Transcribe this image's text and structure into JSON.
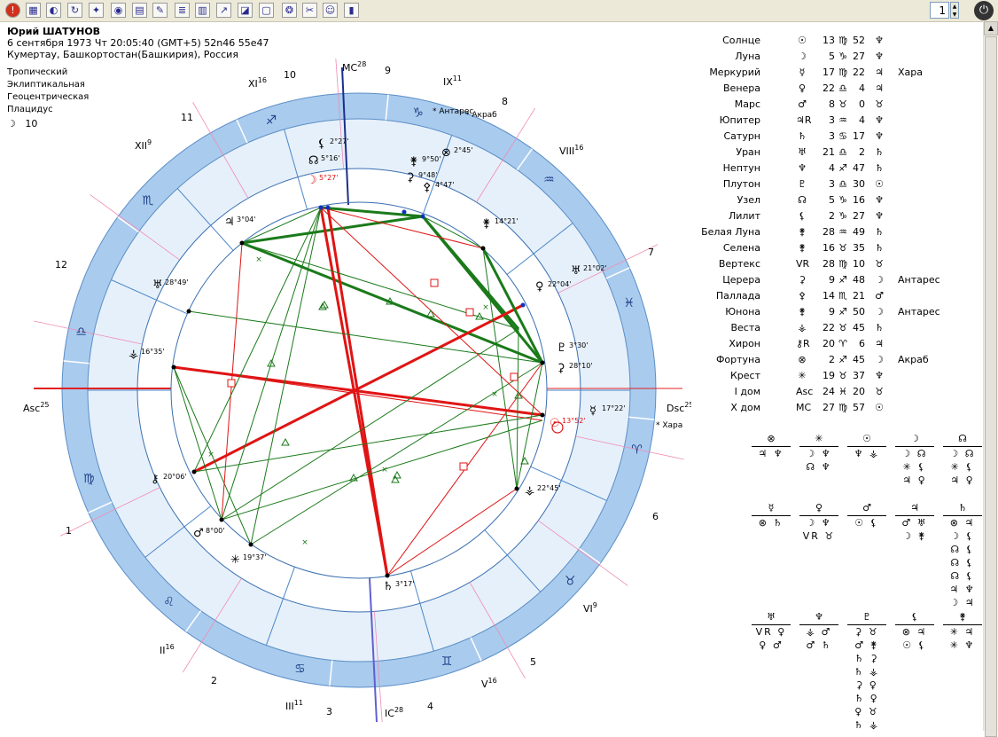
{
  "toolbar": {
    "buttons": [
      "exclamation-icon",
      "grid-icon",
      "globe-icon",
      "refresh-icon",
      "star-map-icon",
      "orbit-icon",
      "calendar-icon",
      "pen-icon",
      "list-icon",
      "chart-icon",
      "transit-icon",
      "graph-icon",
      "page-icon",
      "wheel-icon",
      "tools-icon",
      "person-icon",
      "bars-icon"
    ],
    "page_value": "1",
    "exit_icon": "power-icon"
  },
  "header": {
    "name": "Юрий ШАТУНОВ",
    "line1": "6 сентября 1973  Чт  20:05:40 (GMT+5) 52n46  55e47",
    "line2": "Кумертау, Башкортостан(Башкирия), Россия"
  },
  "systems": [
    "Тропический",
    "Эклиптикальная",
    "Геоцентрическая",
    "Плацидус"
  ],
  "moon_day": {
    "symbol": "☽",
    "value": "10"
  },
  "axes": {
    "mc": "MC",
    "mc_deg": "28",
    "ic": "IC",
    "ic_deg": "28",
    "asc": "Asc",
    "asc_deg": "25",
    "dsc": "Dsc",
    "dsc_deg": "25"
  },
  "houses": [
    {
      "label": "XI",
      "deg": "16"
    },
    {
      "label": "IX",
      "deg": "11"
    },
    {
      "label": "XII",
      "deg": "9"
    },
    {
      "label": "VIII",
      "deg": "16"
    },
    {
      "label": "II",
      "deg": "16"
    },
    {
      "label": "VI",
      "deg": "9"
    },
    {
      "label": "III",
      "deg": "11"
    },
    {
      "label": "V",
      "deg": "16"
    }
  ],
  "house_numbers": [
    "10",
    "9",
    "11",
    "8",
    "12",
    "7",
    "1",
    "6",
    "2",
    "5",
    "3",
    "4"
  ],
  "zodiac_signs": [
    "♑",
    "♐",
    "♒",
    "♏",
    "♓",
    "♎",
    "♈",
    "♍",
    "♉",
    "♌",
    "♊",
    "♋"
  ],
  "chart_planets": [
    {
      "sym": "⚸",
      "deg": "2°27'",
      "color": "#000"
    },
    {
      "sym": "☊",
      "deg": "5°16'",
      "color": "#000"
    },
    {
      "sym": "☽",
      "deg": "5°27'",
      "color": "#e01010"
    },
    {
      "sym": "⚵",
      "deg": "9°50'",
      "color": "#000"
    },
    {
      "sym": "⊗",
      "deg": "2°45'",
      "color": "#000"
    },
    {
      "sym": "⚳",
      "deg": "9°48'",
      "color": "#000"
    },
    {
      "sym": "⚴",
      "deg": "4°47'",
      "color": "#000"
    },
    {
      "sym": "♃",
      "deg": "3°04'",
      "color": "#000"
    },
    {
      "sym": "♅",
      "deg": "28°49'",
      "color": "#000"
    },
    {
      "sym": "⚶",
      "deg": "16°35'",
      "color": "#000"
    },
    {
      "sym": "⚷",
      "deg": "20°06'",
      "color": "#000"
    },
    {
      "sym": "♂",
      "deg": "8°00'",
      "color": "#000"
    },
    {
      "sym": "✳",
      "deg": "19°37'",
      "color": "#000"
    },
    {
      "sym": "♄",
      "deg": "3°17'",
      "color": "#000"
    },
    {
      "sym": "⚶",
      "deg": "22°45'",
      "color": "#000"
    },
    {
      "sym": "☿",
      "deg": "17°22'",
      "color": "#000"
    },
    {
      "sym": "☉",
      "deg": "13°52'",
      "color": "#e01010"
    },
    {
      "sym": "⚳",
      "deg": "28°10'",
      "color": "#000"
    },
    {
      "sym": "♇",
      "deg": "3°30'",
      "color": "#000"
    },
    {
      "sym": "♀",
      "deg": "22°04'",
      "color": "#000"
    },
    {
      "sym": "♅",
      "deg": "21°02'",
      "color": "#000"
    },
    {
      "sym": "⚵",
      "deg": "14°21'",
      "color": "#000"
    }
  ],
  "fixed_stars": [
    "Антарес",
    "Акраб",
    "Хара"
  ],
  "planet_table": [
    {
      "name": "Солнце",
      "sym": "☉",
      "deg": "13",
      "sign": "♍",
      "min": "52",
      "ruler": "♆",
      "star": ""
    },
    {
      "name": "Луна",
      "sym": "☽",
      "deg": "5",
      "sign": "♑",
      "min": "27",
      "ruler": "♆",
      "star": ""
    },
    {
      "name": "Меркурий",
      "sym": "☿",
      "deg": "17",
      "sign": "♍",
      "min": "22",
      "ruler": "♃",
      "star": "Хара"
    },
    {
      "name": "Венера",
      "sym": "♀",
      "deg": "22",
      "sign": "♎",
      "min": "4",
      "ruler": "♃",
      "star": ""
    },
    {
      "name": "Марс",
      "sym": "♂",
      "deg": "8",
      "sign": "♉",
      "min": "0",
      "ruler": "♉",
      "star": ""
    },
    {
      "name": "Юпитер",
      "sym": "♃R",
      "deg": "3",
      "sign": "♒",
      "min": "4",
      "ruler": "♆",
      "star": ""
    },
    {
      "name": "Сатурн",
      "sym": "♄",
      "deg": "3",
      "sign": "♋",
      "min": "17",
      "ruler": "♆",
      "star": ""
    },
    {
      "name": "Уран",
      "sym": "♅",
      "deg": "21",
      "sign": "♎",
      "min": "2",
      "ruler": "♄",
      "star": ""
    },
    {
      "name": "Нептун",
      "sym": "♆",
      "deg": "4",
      "sign": "♐",
      "min": "47",
      "ruler": "♄",
      "star": ""
    },
    {
      "name": "Плутон",
      "sym": "♇",
      "deg": "3",
      "sign": "♎",
      "min": "30",
      "ruler": "☉",
      "star": ""
    },
    {
      "name": "Узел",
      "sym": "☊",
      "deg": "5",
      "sign": "♑",
      "min": "16",
      "ruler": "♆",
      "star": ""
    },
    {
      "name": "Лилит",
      "sym": "⚸",
      "deg": "2",
      "sign": "♑",
      "min": "27",
      "ruler": "♆",
      "star": ""
    },
    {
      "name": "Белая Луна",
      "sym": "⚵",
      "deg": "28",
      "sign": "♒",
      "min": "49",
      "ruler": "♄",
      "star": ""
    },
    {
      "name": "Селена",
      "sym": "⚵",
      "deg": "16",
      "sign": "♉",
      "min": "35",
      "ruler": "♄",
      "star": ""
    },
    {
      "name": "Вертекс",
      "sym": "VR",
      "deg": "28",
      "sign": "♍",
      "min": "10",
      "ruler": "♉",
      "star": ""
    },
    {
      "name": "Церера",
      "sym": "⚳",
      "deg": "9",
      "sign": "♐",
      "min": "48",
      "ruler": "☽",
      "star": "Антарес"
    },
    {
      "name": "Паллада",
      "sym": "⚴",
      "deg": "14",
      "sign": "♏",
      "min": "21",
      "ruler": "♂",
      "star": ""
    },
    {
      "name": "Юнона",
      "sym": "⚵",
      "deg": "9",
      "sign": "♐",
      "min": "50",
      "ruler": "☽",
      "star": "Антарес"
    },
    {
      "name": "Веста",
      "sym": "⚶",
      "deg": "22",
      "sign": "♉",
      "min": "45",
      "ruler": "♄",
      "star": ""
    },
    {
      "name": "Хирон",
      "sym": "⚷R",
      "deg": "20",
      "sign": "♈",
      "min": "6",
      "ruler": "♃",
      "star": ""
    },
    {
      "name": "Фортуна",
      "sym": "⊗",
      "deg": "2",
      "sign": "♐",
      "min": "45",
      "ruler": "☽",
      "star": "Акраб"
    },
    {
      "name": "Крест",
      "sym": "✳",
      "deg": "19",
      "sign": "♉",
      "min": "37",
      "ruler": "♆",
      "star": ""
    },
    {
      "name": "I дом",
      "sym": "Asc",
      "deg": "24",
      "sign": "♓",
      "min": "20",
      "ruler": "♉",
      "star": ""
    },
    {
      "name": "X дом",
      "sym": "MC",
      "deg": "27",
      "sign": "♍",
      "min": "57",
      "ruler": "☉",
      "star": ""
    }
  ],
  "dispositors": [
    {
      "head": "⊗",
      "lines": [
        "♃ ♆"
      ]
    },
    {
      "head": "✳",
      "lines": [
        "☽ ♆",
        "☊ ♆"
      ]
    },
    {
      "head": "☉",
      "lines": [
        "♆ ⚶"
      ]
    },
    {
      "head": "☽",
      "lines": [
        "☽ ☊",
        "✳ ⚸",
        "♃ ♀"
      ]
    },
    {
      "head": "☊",
      "lines": [
        "☽ ☊",
        "✳ ⚸",
        "♃ ♀"
      ]
    },
    {
      "head": "☿",
      "lines": [
        "⊗ ♄"
      ]
    },
    {
      "head": "♀",
      "lines": [
        "☽ ♆",
        "VR ♉"
      ]
    },
    {
      "head": "♂",
      "lines": [
        "☉ ⚸"
      ]
    },
    {
      "head": "♃",
      "lines": [
        "♂ ♅",
        "☽ ⚵"
      ]
    },
    {
      "head": "♄",
      "lines": [
        "⊗ ♃",
        "☽ ⚸",
        "☊ ⚸",
        "☊ ⚸",
        "☊ ⚸",
        "♃ ♆",
        "☽ ♃"
      ]
    },
    {
      "head": "♅",
      "lines": [
        "VR ♀",
        "♀ ♂"
      ]
    },
    {
      "head": "♆",
      "lines": [
        "⚶ ♂",
        "♂ ♄"
      ]
    },
    {
      "head": "♇",
      "lines": [
        "⚳ ♉",
        "♂ ⚵",
        "♄ ⚳",
        "♄ ⚶",
        "⚳ ♀",
        "♄ ♀",
        "♀ ♉",
        "♄ ⚶"
      ]
    },
    {
      "head": "⚸",
      "lines": [
        "⊗ ♃",
        "☉ ⚸"
      ]
    },
    {
      "head": "⚵",
      "lines": [
        "✳ ♃",
        "✳ ♆"
      ]
    }
  ]
}
